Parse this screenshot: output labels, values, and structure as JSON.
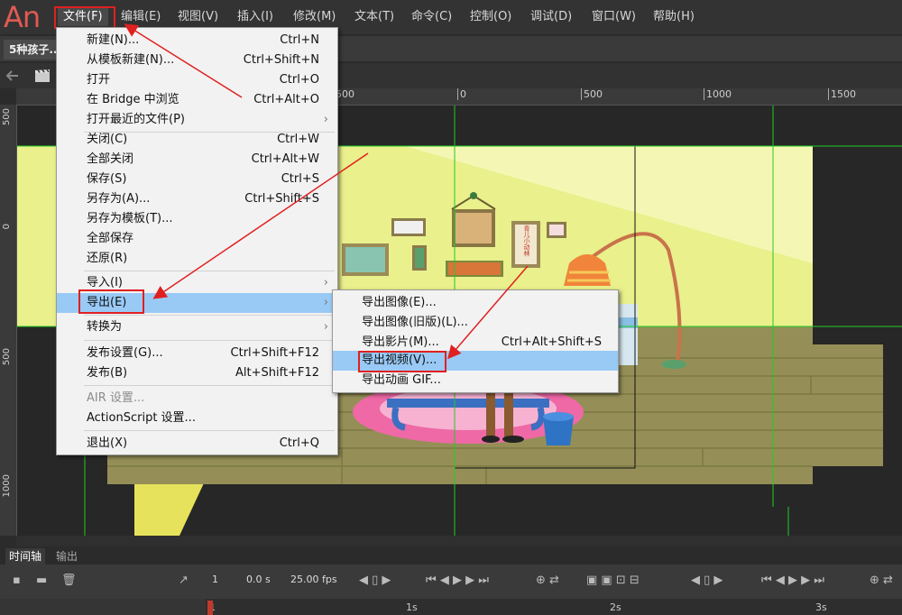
{
  "app": {
    "logo": "An"
  },
  "menubar": {
    "items": [
      "文件(F)",
      "编辑(E)",
      "视图(V)",
      "插入(I)",
      "修改(M)",
      "文本(T)",
      "命令(C)",
      "控制(O)",
      "调试(D)",
      "窗口(W)",
      "帮助(H)"
    ],
    "active": "文件(F)"
  },
  "document": {
    "tab_title": "5种孩子..."
  },
  "rulers": {
    "top": [
      "500",
      "0",
      "500",
      "1000",
      "1500"
    ],
    "left": [
      "500",
      "0",
      "500",
      "1000"
    ]
  },
  "file_menu": {
    "items": [
      {
        "label": "新建(N)...",
        "shortcut": "Ctrl+N"
      },
      {
        "label": "从模板新建(N)...",
        "shortcut": "Ctrl+Shift+N"
      },
      {
        "label": "打开",
        "shortcut": "Ctrl+O"
      },
      {
        "label": "在 Bridge 中浏览",
        "shortcut": "Ctrl+Alt+O"
      },
      {
        "label": "打开最近的文件(P)",
        "shortcut": "",
        "submenu": true
      },
      {
        "label": "关闭(C)",
        "shortcut": "Ctrl+W"
      },
      {
        "label": "全部关闭",
        "shortcut": "Ctrl+Alt+W"
      },
      {
        "label": "保存(S)",
        "shortcut": "Ctrl+S"
      },
      {
        "label": "另存为(A)...",
        "shortcut": "Ctrl+Shift+S"
      },
      {
        "label": "另存为模板(T)...",
        "shortcut": ""
      },
      {
        "label": "全部保存",
        "shortcut": ""
      },
      {
        "label": "还原(R)",
        "shortcut": ""
      },
      {
        "label": "导入(I)",
        "shortcut": "",
        "submenu": true
      },
      {
        "label": "导出(E)",
        "shortcut": "",
        "submenu": true,
        "highlighted": true
      },
      {
        "label": "转换为",
        "shortcut": "",
        "submenu": true
      },
      {
        "label": "发布设置(G)...",
        "shortcut": "Ctrl+Shift+F12"
      },
      {
        "label": "发布(B)",
        "shortcut": "Alt+Shift+F12"
      },
      {
        "label": "AIR 设置...",
        "shortcut": "",
        "disabled": true
      },
      {
        "label": "ActionScript 设置...",
        "shortcut": ""
      },
      {
        "label": "退出(X)",
        "shortcut": "Ctrl+Q"
      }
    ]
  },
  "export_menu": {
    "items": [
      {
        "label": "导出图像(E)...",
        "shortcut": ""
      },
      {
        "label": "导出图像(旧版)(L)...",
        "shortcut": ""
      },
      {
        "label": "导出影片(M)...",
        "shortcut": "Ctrl+Alt+Shift+S"
      },
      {
        "label": "导出视频(V)...",
        "shortcut": "",
        "highlighted": true
      },
      {
        "label": "导出动画 GIF...",
        "shortcut": ""
      }
    ]
  },
  "stage": {
    "poster_text": "青儿小动林"
  },
  "timeline": {
    "tabs": [
      "时间轴",
      "输出"
    ],
    "frame": "1",
    "time": "0.0 s",
    "fps": "25.00 fps",
    "ticks": [
      "1",
      "1s",
      "2s",
      "3s"
    ]
  },
  "colors": {
    "highlight": "#99c9f5",
    "annotation": "#e02020",
    "guide": "#22cc22",
    "wall": "#e8f08a",
    "floor": "#8f8a52"
  }
}
